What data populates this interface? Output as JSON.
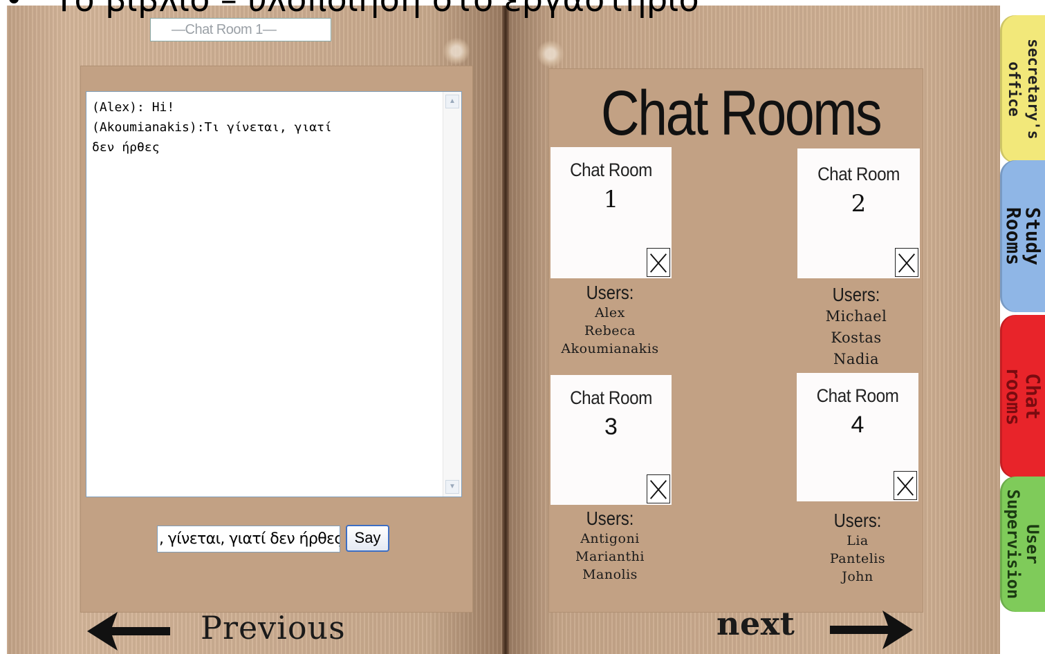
{
  "slide": {
    "bullet": "•",
    "title": "Το βιβλίο – υλοποίηση στο εργαστήριο"
  },
  "chat": {
    "room_label": "—Chat Room 1—",
    "messages": [
      "(Alex): Hi!",
      "(Akoumianakis):Τι γίνεται, γιατί",
      "δεν ήρθες"
    ],
    "input_value": ", γίνεται, γιατί δεν ήρθες",
    "say_label": "Say"
  },
  "nav": {
    "previous_label": "Previous",
    "next_label": "next"
  },
  "rooms_page": {
    "title": "Chat Rooms",
    "users_heading": "Users:",
    "rooms": [
      {
        "title": "Chat Room",
        "number": "1",
        "users": [
          "Alex",
          "Rebeca",
          "Akoumianakis"
        ]
      },
      {
        "title": "Chat Room",
        "number": "2",
        "users": [
          "Michael",
          "Kostas",
          "Nadia"
        ]
      },
      {
        "title": "Chat Room",
        "number": "3",
        "users": [
          "Antigoni",
          "Marianthi",
          "Manolis"
        ]
      },
      {
        "title": "Chat Room",
        "number": "4",
        "users": [
          "Lia",
          "Pantelis",
          "John"
        ]
      }
    ]
  },
  "tabs": [
    {
      "label_line1": "secretary's",
      "label_line2": "office",
      "color": "#f2e87a",
      "text_color": "#222222"
    },
    {
      "label_line1": "Study",
      "label_line2": "Rooms",
      "color": "#8fb6e6",
      "text_color": "#111111"
    },
    {
      "label_line1": "Chat",
      "label_line2": "rooms",
      "color": "#e8242a",
      "text_color": "#7a0b10"
    },
    {
      "label_line1": "User",
      "label_line2": "Supervision",
      "color": "#7fcb5a",
      "text_color": "#1b3a12"
    }
  ]
}
